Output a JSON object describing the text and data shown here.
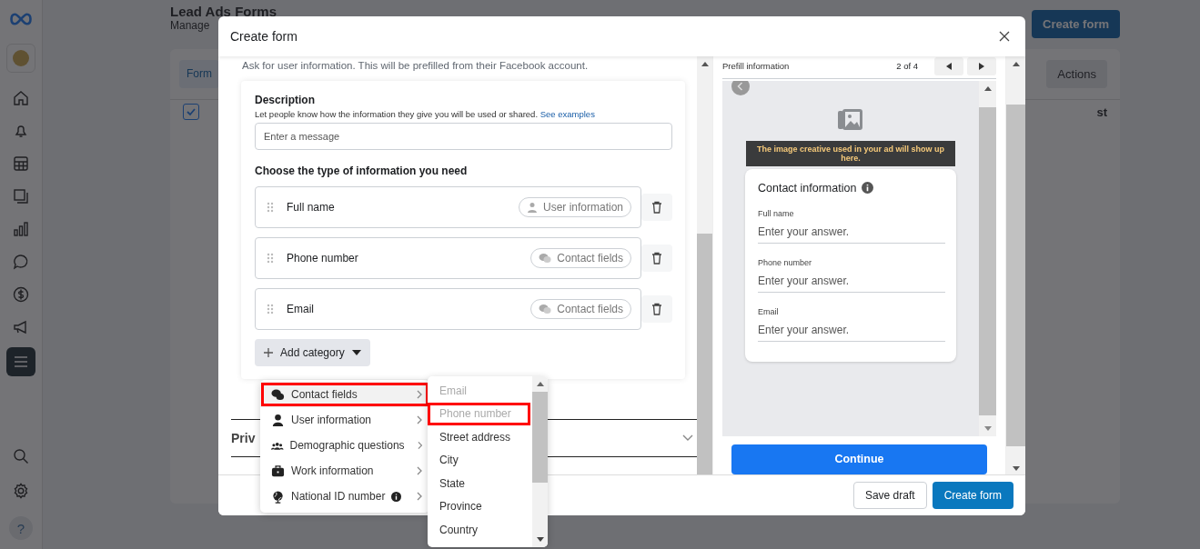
{
  "sidebar": {
    "items": [
      {
        "kind": "home",
        "selected": false
      },
      {
        "kind": "bell",
        "selected": false
      },
      {
        "kind": "table",
        "selected": false
      },
      {
        "kind": "windows",
        "selected": false
      },
      {
        "kind": "chart",
        "selected": false
      },
      {
        "kind": "chat",
        "selected": false
      },
      {
        "kind": "dollar",
        "selected": false
      },
      {
        "kind": "megaphone",
        "selected": false
      },
      {
        "kind": "menu",
        "selected": true
      }
    ],
    "bottom": [
      {
        "kind": "search"
      },
      {
        "kind": "settings"
      }
    ],
    "help": "?"
  },
  "page": {
    "title": "Lead Ads Forms",
    "subtitle": "Manage",
    "tab": "Form",
    "select_all_checked": true,
    "actions": "Actions",
    "create_button": "Create form",
    "column_header": "st"
  },
  "modal": {
    "title": "Create form",
    "intro": "Ask for user information. This will be prefilled from their Facebook account.",
    "card": {
      "label": "Description",
      "help": "Let people know how the information they give you will be used or shared.",
      "link": "See examples",
      "placeholder": "Enter a message",
      "question": "Choose the type of information you need",
      "fields": [
        {
          "label": "Full name",
          "tag": "User information",
          "kind": "user"
        },
        {
          "label": "Phone number",
          "tag": "Contact fields",
          "kind": "contact"
        },
        {
          "label": "Email",
          "tag": "Contact fields",
          "kind": "contact"
        }
      ],
      "add_button": "Add category"
    },
    "section": "Priv",
    "category_menu": [
      {
        "label": "Contact fields",
        "kind": "contact",
        "info": false,
        "selected": true,
        "annotated": true
      },
      {
        "label": "User information",
        "kind": "user",
        "info": false,
        "selected": false,
        "annotated": false
      },
      {
        "label": "Demographic questions",
        "kind": "group",
        "info": false,
        "selected": false,
        "annotated": false
      },
      {
        "label": "Work information",
        "kind": "work",
        "info": false,
        "selected": false,
        "annotated": false
      },
      {
        "label": "National ID number",
        "kind": "globe",
        "info": true,
        "selected": false,
        "annotated": false
      }
    ],
    "option_menu": [
      {
        "label": "Email",
        "disabled": true,
        "annotated": false
      },
      {
        "label": "Phone number",
        "disabled": true,
        "annotated": true
      },
      {
        "label": "Street address",
        "disabled": false,
        "annotated": false
      },
      {
        "label": "City",
        "disabled": false,
        "annotated": false
      },
      {
        "label": "State",
        "disabled": false,
        "annotated": false
      },
      {
        "label": "Province",
        "disabled": false,
        "annotated": false
      },
      {
        "label": "Country",
        "disabled": false,
        "annotated": false
      }
    ],
    "preview": {
      "heading": "Prefill information",
      "pager": "2 of 4",
      "banner": "The image creative used in your ad will show up here.",
      "card_title": "Contact information",
      "fields": [
        {
          "label": "Full name",
          "placeholder": "Enter your answer."
        },
        {
          "label": "Phone number",
          "placeholder": "Enter your answer."
        },
        {
          "label": "Email",
          "placeholder": "Enter your answer."
        }
      ],
      "continue": "Continue"
    },
    "footer": {
      "save": "Save draft",
      "create": "Create form"
    }
  }
}
